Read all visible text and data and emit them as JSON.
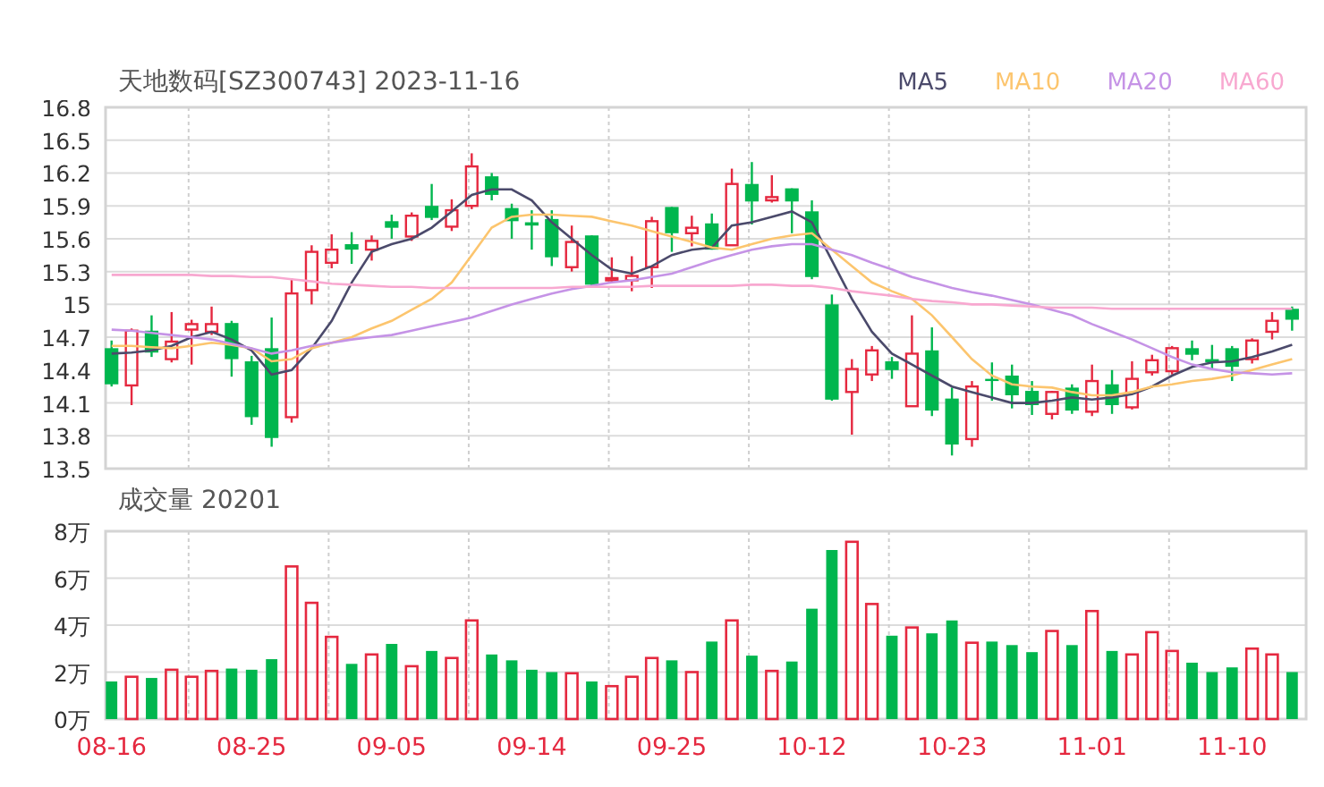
{
  "price_chart": {
    "chart_data": {
      "type": "candlestick",
      "title": "天地数码[SZ300743] 2023-11-16",
      "grid": true,
      "categories": [
        null,
        null,
        null,
        null,
        null,
        null,
        null,
        null,
        null,
        null,
        null,
        null,
        null,
        null,
        null,
        null,
        null,
        null,
        null,
        null,
        null,
        null,
        null,
        null,
        null,
        null,
        null,
        null,
        null,
        null,
        null,
        null,
        null,
        null,
        null,
        null,
        null,
        null,
        null,
        null,
        null,
        null,
        null,
        null,
        null,
        null,
        null,
        null,
        null,
        null,
        null,
        null,
        null,
        null,
        null,
        null,
        null,
        null,
        null,
        null
      ],
      "ylim": [
        13.5,
        16.8
      ],
      "yticks": [
        16.8,
        16.5,
        16.2,
        15.9,
        15.6,
        15.3,
        15,
        14.7,
        14.4,
        14.1,
        13.8,
        13.5
      ],
      "ohlc": [
        [
          14.6,
          14.67,
          14.25,
          14.27
        ],
        [
          14.26,
          14.78,
          14.08,
          14.76
        ],
        [
          14.76,
          14.9,
          14.52,
          14.56
        ],
        [
          14.5,
          14.93,
          14.47,
          14.66
        ],
        [
          14.77,
          14.86,
          14.45,
          14.82
        ],
        [
          14.75,
          14.98,
          14.72,
          14.82
        ],
        [
          14.83,
          14.85,
          14.34,
          14.5
        ],
        [
          14.48,
          14.53,
          13.9,
          13.97
        ],
        [
          14.6,
          14.88,
          13.7,
          13.78
        ],
        [
          13.97,
          15.24,
          13.92,
          15.1
        ],
        [
          15.13,
          15.54,
          15.0,
          15.48
        ],
        [
          15.38,
          15.64,
          15.33,
          15.5
        ],
        [
          15.55,
          15.66,
          15.37,
          15.5
        ],
        [
          15.5,
          15.63,
          15.4,
          15.58
        ],
        [
          15.76,
          15.82,
          15.6,
          15.7
        ],
        [
          15.62,
          15.84,
          15.58,
          15.81
        ],
        [
          15.9,
          16.1,
          15.77,
          15.79
        ],
        [
          15.71,
          15.96,
          15.67,
          15.86
        ],
        [
          15.9,
          16.38,
          15.87,
          16.26
        ],
        [
          16.17,
          16.2,
          15.95,
          16.0
        ],
        [
          15.88,
          15.92,
          15.6,
          15.76
        ],
        [
          15.75,
          15.86,
          15.5,
          15.72
        ],
        [
          15.78,
          15.86,
          15.35,
          15.43
        ],
        [
          15.34,
          15.72,
          15.3,
          15.57
        ],
        [
          15.63,
          15.63,
          15.16,
          15.18
        ],
        [
          15.22,
          15.43,
          15.2,
          15.24
        ],
        [
          15.22,
          15.44,
          15.12,
          15.26
        ],
        [
          15.34,
          15.8,
          15.15,
          15.76
        ],
        [
          15.89,
          15.89,
          15.48,
          15.65
        ],
        [
          15.65,
          15.81,
          15.53,
          15.7
        ],
        [
          15.74,
          15.83,
          15.5,
          15.5
        ],
        [
          15.54,
          16.24,
          15.54,
          16.1
        ],
        [
          16.1,
          16.3,
          15.73,
          15.94
        ],
        [
          15.95,
          16.18,
          15.93,
          15.98
        ],
        [
          16.06,
          16.06,
          15.65,
          15.94
        ],
        [
          15.85,
          15.95,
          15.23,
          15.25
        ],
        [
          15.0,
          15.09,
          14.12,
          14.13
        ],
        [
          14.2,
          14.5,
          13.81,
          14.41
        ],
        [
          14.36,
          14.62,
          14.3,
          14.58
        ],
        [
          14.48,
          14.52,
          14.32,
          14.4
        ],
        [
          14.07,
          14.9,
          14.07,
          14.55
        ],
        [
          14.58,
          14.79,
          13.98,
          14.03
        ],
        [
          14.14,
          14.24,
          13.62,
          13.72
        ],
        [
          13.77,
          14.3,
          13.7,
          14.25
        ],
        [
          14.32,
          14.47,
          14.12,
          14.3
        ],
        [
          14.35,
          14.45,
          14.05,
          14.17
        ],
        [
          14.21,
          14.3,
          13.99,
          14.08
        ],
        [
          14.0,
          14.21,
          13.95,
          14.2
        ],
        [
          14.24,
          14.27,
          14.0,
          14.03
        ],
        [
          14.02,
          14.45,
          13.98,
          14.3
        ],
        [
          14.27,
          14.4,
          14.0,
          14.08
        ],
        [
          14.06,
          14.48,
          14.04,
          14.32
        ],
        [
          14.38,
          14.54,
          14.35,
          14.49
        ],
        [
          14.39,
          14.62,
          14.36,
          14.6
        ],
        [
          14.6,
          14.67,
          14.49,
          14.54
        ],
        [
          14.5,
          14.63,
          14.41,
          14.47
        ],
        [
          14.6,
          14.62,
          14.3,
          14.43
        ],
        [
          14.5,
          14.69,
          14.46,
          14.67
        ],
        [
          14.75,
          14.93,
          14.68,
          14.85
        ],
        [
          14.96,
          14.98,
          14.76,
          14.86
        ]
      ]
    }
  },
  "moving_averages": {
    "chart_data": {
      "type": "line",
      "categories": [
        null,
        null,
        null,
        null,
        null,
        null,
        null,
        null,
        null,
        null,
        null,
        null,
        null,
        null,
        null,
        null,
        null,
        null,
        null,
        null,
        null,
        null,
        null,
        null,
        null,
        null,
        null,
        null,
        null,
        null,
        null,
        null,
        null,
        null,
        null,
        null,
        null,
        null,
        null,
        null,
        null,
        null,
        null,
        null,
        null,
        null,
        null,
        null,
        null,
        null,
        null,
        null,
        null,
        null,
        null,
        null,
        null,
        null,
        null,
        null
      ],
      "ylim": [
        13.5,
        16.8
      ],
      "series": [
        {
          "name": "MA5",
          "color": "#4b4a6b",
          "values": [
            14.55,
            14.56,
            14.58,
            14.62,
            14.7,
            14.75,
            14.68,
            14.58,
            14.36,
            14.4,
            14.6,
            14.85,
            15.2,
            15.48,
            15.55,
            15.6,
            15.7,
            15.85,
            16.0,
            16.05,
            16.05,
            15.95,
            15.75,
            15.6,
            15.45,
            15.32,
            15.28,
            15.35,
            15.45,
            15.5,
            15.52,
            15.72,
            15.75,
            15.8,
            15.85,
            15.75,
            15.4,
            15.05,
            14.75,
            14.55,
            14.45,
            14.35,
            14.25,
            14.2,
            14.15,
            14.1,
            14.1,
            14.12,
            14.15,
            14.13,
            14.15,
            14.18,
            14.25,
            14.35,
            14.43,
            14.47,
            14.48,
            14.52,
            14.57,
            14.63
          ]
        },
        {
          "name": "MA10",
          "color": "#fcc56e",
          "values": [
            14.62,
            14.62,
            14.61,
            14.6,
            14.62,
            14.65,
            14.63,
            14.6,
            14.48,
            14.5,
            14.6,
            14.65,
            14.7,
            14.78,
            14.85,
            14.95,
            15.05,
            15.2,
            15.45,
            15.7,
            15.8,
            15.82,
            15.82,
            15.81,
            15.8,
            15.76,
            15.72,
            15.67,
            15.62,
            15.57,
            15.52,
            15.5,
            15.55,
            15.6,
            15.63,
            15.65,
            15.5,
            15.35,
            15.2,
            15.12,
            15.05,
            14.9,
            14.7,
            14.5,
            14.35,
            14.27,
            14.25,
            14.24,
            14.2,
            14.17,
            14.17,
            14.2,
            14.25,
            14.27,
            14.3,
            14.32,
            14.35,
            14.4,
            14.45,
            14.5
          ]
        },
        {
          "name": "MA20",
          "color": "#c593e6",
          "values": [
            14.77,
            14.76,
            14.74,
            14.72,
            14.7,
            14.68,
            14.64,
            14.6,
            14.55,
            14.58,
            14.62,
            14.65,
            14.68,
            14.7,
            14.72,
            14.76,
            14.8,
            14.84,
            14.88,
            14.94,
            15.0,
            15.05,
            15.1,
            15.14,
            15.17,
            15.2,
            15.22,
            15.25,
            15.28,
            15.34,
            15.4,
            15.45,
            15.5,
            15.53,
            15.55,
            15.55,
            15.5,
            15.45,
            15.38,
            15.32,
            15.25,
            15.2,
            15.15,
            15.11,
            15.08,
            15.04,
            15.0,
            14.95,
            14.9,
            14.82,
            14.75,
            14.68,
            14.6,
            14.52,
            14.45,
            14.41,
            14.38,
            14.37,
            14.36,
            14.37
          ]
        },
        {
          "name": "MA60",
          "color": "#f8a8d0",
          "values": [
            15.27,
            15.27,
            15.27,
            15.27,
            15.27,
            15.26,
            15.26,
            15.25,
            15.25,
            15.23,
            15.21,
            15.19,
            15.18,
            15.17,
            15.16,
            15.16,
            15.15,
            15.15,
            15.15,
            15.15,
            15.15,
            15.15,
            15.15,
            15.16,
            15.16,
            15.16,
            15.16,
            15.17,
            15.17,
            15.17,
            15.17,
            15.17,
            15.18,
            15.18,
            15.17,
            15.17,
            15.15,
            15.12,
            15.1,
            15.08,
            15.05,
            15.03,
            15.02,
            15.0,
            15.0,
            14.99,
            14.98,
            14.97,
            14.97,
            14.97,
            14.96,
            14.96,
            14.96,
            14.96,
            14.96,
            14.96,
            14.96,
            14.96,
            14.96,
            14.96
          ]
        }
      ]
    }
  },
  "volume_chart": {
    "chart_data": {
      "type": "bar",
      "title": "成交量 20201",
      "stacked": true,
      "grid": true,
      "categories": [
        "08-16",
        null,
        null,
        null,
        null,
        null,
        null,
        "08-25",
        null,
        null,
        null,
        null,
        null,
        null,
        "09-05",
        null,
        null,
        null,
        null,
        null,
        null,
        "09-14",
        null,
        null,
        null,
        null,
        null,
        null,
        "09-25",
        null,
        null,
        null,
        null,
        null,
        null,
        "10-12",
        null,
        null,
        null,
        null,
        null,
        null,
        "10-23",
        null,
        null,
        null,
        null,
        null,
        null,
        "11-01",
        null,
        null,
        null,
        null,
        null,
        null,
        "11-10",
        null,
        null,
        null
      ],
      "ylim": [
        0,
        8
      ],
      "yticks": [
        {
          "value": 8,
          "label": "8万"
        },
        {
          "value": 6,
          "label": "6万"
        },
        {
          "value": 4,
          "label": "4万"
        },
        {
          "value": 2,
          "label": "2万"
        },
        {
          "value": 0,
          "label": "0万"
        }
      ],
      "series": [
        {
          "color": "#e5283f",
          "values": [
            null,
            1.8,
            null,
            2.1,
            1.8,
            2.05,
            null,
            null,
            null,
            6.5,
            4.95,
            3.5,
            null,
            2.75,
            null,
            2.25,
            null,
            2.6,
            4.2,
            null,
            null,
            null,
            null,
            1.95,
            null,
            1.4,
            1.8,
            2.6,
            null,
            2.0,
            null,
            4.2,
            null,
            2.05,
            null,
            null,
            null,
            7.55,
            4.9,
            null,
            3.9,
            null,
            null,
            3.25,
            null,
            null,
            null,
            3.75,
            null,
            4.6,
            null,
            2.75,
            3.7,
            2.9,
            null,
            null,
            null,
            3.0,
            2.75,
            null
          ]
        },
        {
          "color": "#00b64e",
          "values": [
            1.6,
            null,
            1.75,
            null,
            null,
            null,
            2.15,
            2.1,
            2.55,
            null,
            null,
            null,
            2.35,
            null,
            3.2,
            null,
            2.9,
            null,
            null,
            2.75,
            2.5,
            2.1,
            2.0,
            null,
            1.6,
            null,
            null,
            null,
            2.5,
            null,
            3.3,
            null,
            2.7,
            null,
            2.45,
            4.7,
            7.2,
            null,
            null,
            3.55,
            null,
            3.65,
            4.2,
            null,
            3.3,
            3.15,
            2.85,
            null,
            3.15,
            null,
            2.9,
            null,
            null,
            null,
            2.4,
            2.0,
            2.2,
            null,
            null,
            2.0
          ]
        }
      ]
    }
  }
}
